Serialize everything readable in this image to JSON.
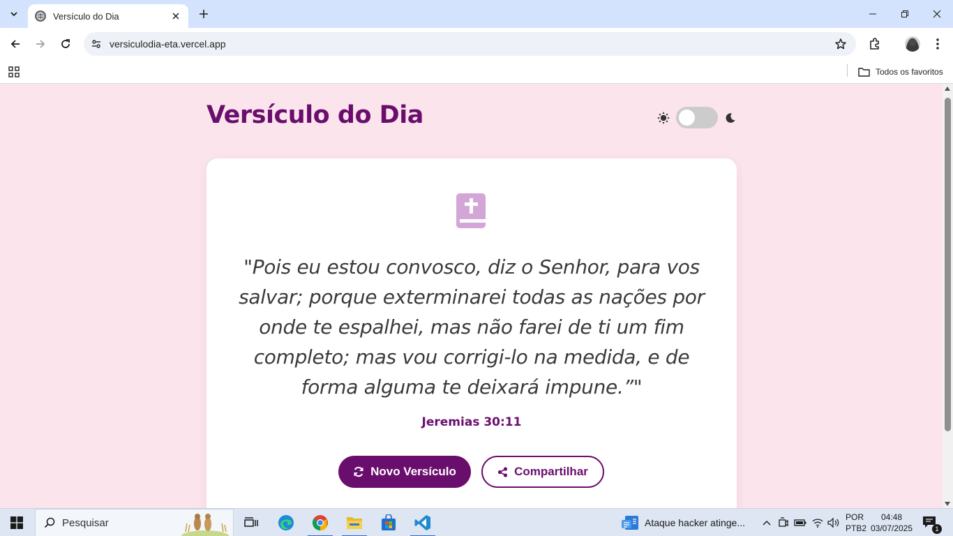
{
  "browser": {
    "tab_title": "Versículo do Dia",
    "url": "versiculodia-eta.vercel.app",
    "bookmarks_all_label": "Todos os favoritos"
  },
  "page": {
    "title": "Versículo do Dia",
    "dark_mode_enabled": false,
    "verse_text": "\"Pois eu estou convosco, diz o Senhor, para vos salvar; porque exterminarei todas as nações por onde te espalhei, mas não farei de ti um fim completo; mas vou corrigi-lo na medida, e de forma alguma te deixará impune.”\"",
    "reference": "Jeremias 30:11",
    "new_verse_label": "Novo Versículo",
    "share_label": "Compartilhar"
  },
  "colors": {
    "brand_purple": "#6a0e6e",
    "page_background": "#fbe4ec",
    "card_background": "#ffffff",
    "icon_lilac": "#d4a6d8"
  },
  "taskbar": {
    "search_placeholder": "Pesquisar",
    "news_text": "Ataque hacker atinge...",
    "language_line1": "POR",
    "language_line2": "PTB2",
    "time": "04:48",
    "date": "03/07/2025",
    "notification_count": "1",
    "apps": [
      "task-view",
      "edge",
      "chrome",
      "file-explorer",
      "microsoft-store",
      "vscode"
    ]
  }
}
